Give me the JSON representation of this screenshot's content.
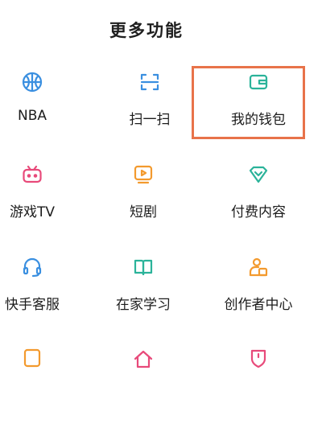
{
  "header": {
    "title": "更多功能"
  },
  "colors": {
    "blue": "#3a8fe0",
    "green": "#2bb39a",
    "orange": "#f39a2e",
    "pink": "#e84a7a",
    "highlight": "#e8734a"
  },
  "items": [
    {
      "label": "NBA",
      "icon": "basketball-icon"
    },
    {
      "label": "扫一扫",
      "icon": "scan-icon"
    },
    {
      "label": "我的钱包",
      "icon": "wallet-icon"
    },
    {
      "label": "游戏TV",
      "icon": "game-tv-icon"
    },
    {
      "label": "短剧",
      "icon": "play-video-icon"
    },
    {
      "label": "付费内容",
      "icon": "diamond-icon"
    },
    {
      "label": "快手客服",
      "icon": "headset-icon"
    },
    {
      "label": "在家学习",
      "icon": "book-icon"
    },
    {
      "label": "创作者中心",
      "icon": "creator-icon"
    },
    {
      "label": "",
      "icon": "partial-orange-icon"
    },
    {
      "label": "",
      "icon": "partial-pink-icon"
    },
    {
      "label": "",
      "icon": "partial-pink-shield-icon"
    }
  ]
}
